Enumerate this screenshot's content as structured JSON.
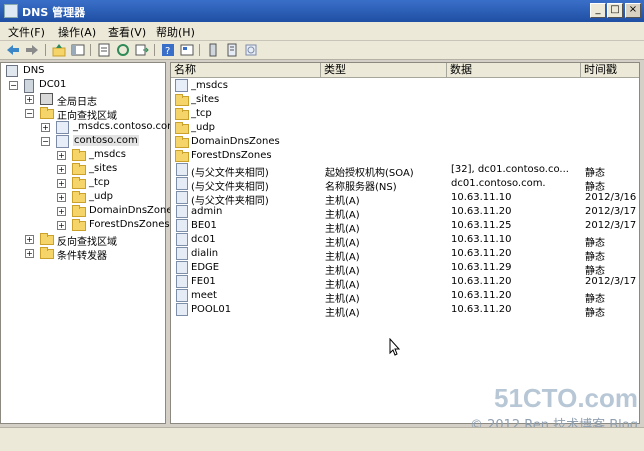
{
  "window": {
    "title": "DNS 管理器",
    "btn_min": "_",
    "btn_max": "□",
    "btn_close": "×"
  },
  "menu": [
    "文件(F)",
    "操作(A)",
    "查看(V)",
    "帮助(H)"
  ],
  "toolbar": [
    "back-icon",
    "forward-icon",
    "up-icon",
    "show-tree-icon",
    "properties-icon",
    "refresh-icon",
    "export-icon",
    "help-icon",
    "details-icon",
    "server-icon",
    "list-icon",
    "zone-icon"
  ],
  "tree": {
    "root": "DNS",
    "server": "DC01",
    "global_logs": "全局日志",
    "forward_zones": "正向查找区域",
    "zone_msdcs": "_msdcs.contoso.com",
    "zone_contoso": "contoso.com",
    "sub": [
      "_msdcs",
      "_sites",
      "_tcp",
      "_udp",
      "DomainDnsZones",
      "ForestDnsZones"
    ],
    "reverse_zones": "反向查找区域",
    "conditional_forwarders": "条件转发器"
  },
  "list": {
    "columns": [
      "名称",
      "类型",
      "数据",
      "时间戳"
    ],
    "rows": [
      {
        "name": "_msdcs",
        "type": "",
        "data": "",
        "ts": "",
        "icon": "zone-icon"
      },
      {
        "name": "_sites",
        "type": "",
        "data": "",
        "ts": "",
        "icon": "folder-icon"
      },
      {
        "name": "_tcp",
        "type": "",
        "data": "",
        "ts": "",
        "icon": "folder-icon"
      },
      {
        "name": "_udp",
        "type": "",
        "data": "",
        "ts": "",
        "icon": "folder-icon"
      },
      {
        "name": "DomainDnsZones",
        "type": "",
        "data": "",
        "ts": "",
        "icon": "folder-icon"
      },
      {
        "name": "ForestDnsZones",
        "type": "",
        "data": "",
        "ts": "",
        "icon": "folder-icon"
      },
      {
        "name": "(与父文件夹相同)",
        "type": "起始授权机构(SOA)",
        "data": "[32], dc01.contoso.co...",
        "ts": "静态",
        "icon": "record-icon"
      },
      {
        "name": "(与父文件夹相同)",
        "type": "名称服务器(NS)",
        "data": "dc01.contoso.com.",
        "ts": "静态",
        "icon": "record-icon"
      },
      {
        "name": "(与父文件夹相同)",
        "type": "主机(A)",
        "data": "10.63.11.10",
        "ts": "2012/3/16 :",
        "icon": "record-icon"
      },
      {
        "name": "admin",
        "type": "主机(A)",
        "data": "10.63.11.20",
        "ts": "2012/3/17",
        "icon": "record-icon"
      },
      {
        "name": "BE01",
        "type": "主机(A)",
        "data": "10.63.11.25",
        "ts": "2012/3/17",
        "icon": "record-icon"
      },
      {
        "name": "dc01",
        "type": "主机(A)",
        "data": "10.63.11.10",
        "ts": "静态",
        "icon": "record-icon"
      },
      {
        "name": "dialin",
        "type": "主机(A)",
        "data": "10.63.11.20",
        "ts": "静态",
        "icon": "record-icon"
      },
      {
        "name": "EDGE",
        "type": "主机(A)",
        "data": "10.63.11.29",
        "ts": "静态",
        "icon": "record-icon"
      },
      {
        "name": "FE01",
        "type": "主机(A)",
        "data": "10.63.11.20",
        "ts": "2012/3/17",
        "icon": "record-icon"
      },
      {
        "name": "meet",
        "type": "主机(A)",
        "data": "10.63.11.20",
        "ts": "静态",
        "icon": "record-icon"
      },
      {
        "name": "POOL01",
        "type": "主机(A)",
        "data": "10.63.11.20",
        "ts": "静态",
        "icon": "record-icon"
      }
    ]
  },
  "watermark": {
    "site": "51CTO.com",
    "line": "© 2012 Ren 技术博客 Blog"
  }
}
